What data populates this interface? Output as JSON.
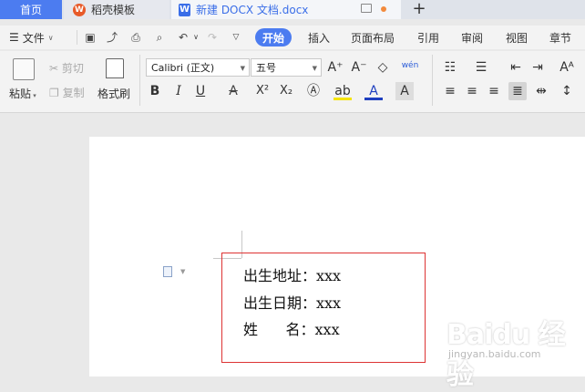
{
  "tabs": {
    "home": "首页",
    "template": "稻壳模板",
    "doc": "新建 DOCX 文档.docx",
    "new_tab": "+"
  },
  "menu": {
    "file": "文件",
    "items": [
      "开始",
      "插入",
      "页面布局",
      "引用",
      "审阅",
      "视图",
      "章节"
    ]
  },
  "ribbon": {
    "paste": "粘贴",
    "cut": "剪切",
    "copy": "复制",
    "format_painter": "格式刷",
    "font_name": "Calibri (正文)",
    "font_size": "五号",
    "bold": "B",
    "italic": "I",
    "underline": "U",
    "strike": "A",
    "superscript": "X²",
    "subscript": "X₂",
    "font_color": "A",
    "pinyin": "wén"
  },
  "document": {
    "lines": [
      "出生地址：xxx",
      "出生日期：xxx",
      "姓      名：xxx"
    ]
  },
  "watermark": {
    "title": "Baidu 经验",
    "subtitle": "jingyan.baidu.com"
  },
  "colors": {
    "accent": "#4c7cf0",
    "highlight_box": "#dd3333",
    "wps_logo": "#e85a2a"
  }
}
